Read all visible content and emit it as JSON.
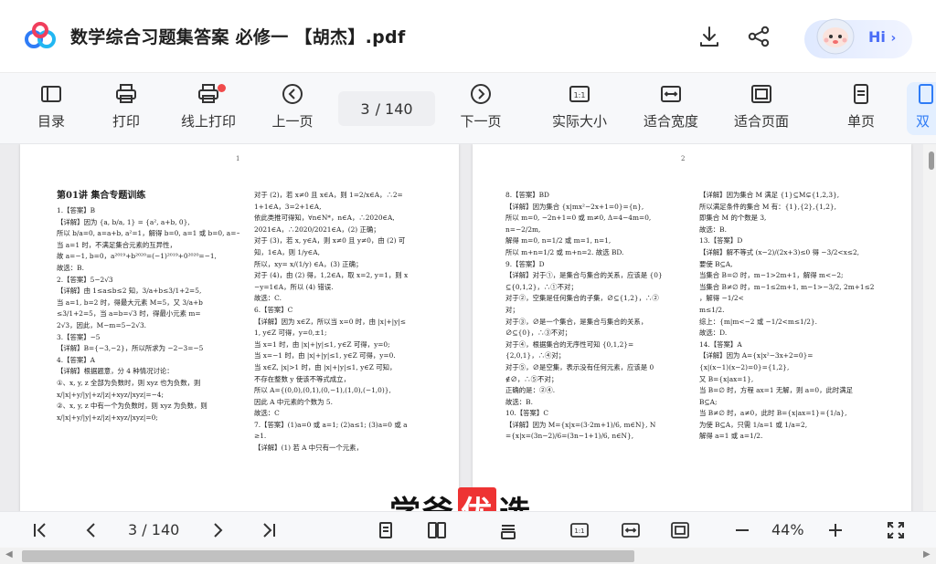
{
  "title_bar": {
    "document_title": "数学综合习题集答案 必修一 【胡杰】.pdf",
    "hi_button": "Hi",
    "icons": [
      "cloud-logo-icon",
      "download-icon",
      "share-icon",
      "assistant-avatar-icon",
      "chevron-right-icon"
    ]
  },
  "toolbar": {
    "items": [
      {
        "label": "目录",
        "icon": "toc-icon"
      },
      {
        "label": "打印",
        "icon": "printer-icon"
      },
      {
        "label": "线上打印",
        "icon": "online-print-icon"
      },
      {
        "label": "上一页",
        "icon": "prev-page-icon"
      },
      {
        "label": "下一页",
        "icon": "next-page-icon"
      },
      {
        "label": "实际大小",
        "icon": "actual-size-icon"
      },
      {
        "label": "适合宽度",
        "icon": "fit-width-icon"
      },
      {
        "label": "适合页面",
        "icon": "fit-page-icon"
      },
      {
        "label": "单页",
        "icon": "single-page-icon"
      },
      {
        "label": "双",
        "icon": "double-page-icon"
      }
    ],
    "page_current": "3",
    "page_total": "/ 140"
  },
  "document": {
    "left_page_number": "1",
    "right_page_number": "2",
    "left_col1": [
      "第01讲  集合专题训练",
      "1.【答案】B",
      "【详解】因为 {a, b/a, 1} = {a², a+b, 0},",
      "所以 b/a=0, a=a+b, a²=1，解得 b=0, a=1 或 b=0, a=−1,",
      "当 a=1 时，不满足集合元素的互异性，",
      "故 a=−1, b=0，a²⁰¹⁹+b²⁰²⁰=(−1)²⁰¹⁹+0²⁰²⁰=−1,",
      "故选：B.",
      "2.【答案】5−2√3",
      "【详解】由 1≤a≤b≤2 知，3/a+b≤3/1+2=5,",
      "当 a=1, b=2 时，得最大元素 M=5，又 3/a+b",
      "≤3/1+2=5，当 a=b=√3 时，得最小元素 m=",
      "2√3，因此，M−m=5−2√3.",
      "3.【答案】−5",
      "【详解】B={−3,−2}，所以所求为 −2−3=−5",
      "4.【答案】A",
      "【详解】根据题意，分 4 种情况讨论：",
      "①、x, y, z 全部为负数时，则 xyz 也为负数，则",
      "x/|x|+y/|y|+z/|z|+xyz/|xyz|=−4;",
      "②、x, y, z 中有一个为负数时，则 xyz 为负数，则",
      "x/|x|+y/|y|+z/|z|+xyz/|xyz|=0;"
    ],
    "left_col2": [
      "对于 (2)，若 x≠0 且 x∈A，则 1=2/x∈A，∴2=",
      "1+1∈A，3=2+1∈A,",
      "依此类推可得知，∀n∈N*，n∈A，∴2020∈A,",
      "2021∈A，∴2020/2021∈A，(2) 正确；",
      "对于 (3)，若 x, y∈A，则 x≠0 且 y≠0，由 (2) 可",
      "知，1∈A，则 1/y∈A,",
      "所以，xy= x/(1/y) ∈A，(3) 正确；",
      "对于 (4)，由 (2) 得，1,2∈A，取 x=2, y=1，则 x",
      "−y=1∈A，所以 (4) 错误.",
      "故选：C.",
      "6.【答案】C",
      "【详解】因为 x∈Z，所以当 x=0 时，由 |x|+|y|≤",
      "1, y∈Z 可得，y=0,±1;",
      "当 x=1 时，由 |x|+|y|≤1, y∈Z 可得，y=0;",
      "当 x=−1 时，由 |x|+|y|≤1, y∈Z 可得，y=0.",
      "当 x∈Z, |x|>1 时，由 |x|+|y|≤1, y∈Z 可知，",
      "不存在整数 y 使该不等式成立，",
      "所以 A={(0,0),(0,1),(0,−1),(1,0),(−1,0)},",
      "因此 A 中元素的个数为 5.",
      "故选：C",
      "7.【答案】(1)a=0 或 a=1; (2)a≤1; (3)a=0 或 a",
      "≥1.",
      "【详解】(1) 若 A 中只有一个元素，"
    ],
    "right_col1": [
      "8.【答案】BD",
      "【详解】因为集合 {x|mx²−2x+1=0}={n},",
      "所以 m=0, −2n+1=0 或 m≠0, Δ=4−4m=0,",
      "n=−2/2m,",
      "解得 m=0, n=1/2 或 m=1, n=1,",
      "所以 m+n=1/2 或 m+n=2. 故选 BD.",
      "9.【答案】D",
      "【详解】对于①，是集合与集合的关系，应该是 {0}",
      "⊆{0,1,2}，∴①不对；",
      "对于②，空集是任何集合的子集，∅⊆{1,2}，∴②",
      "对；",
      "对于③，∅是一个集合，是集合与集合的关系，",
      "∅⊆{0}，∴③不对；",
      "对于④，根据集合的无序性可知 {0,1,2}=",
      "{2,0,1}，∴④对；",
      "对于⑤，∅是空集，表示没有任何元素，应该是 0",
      "∉∅，∴⑤不对；",
      "正确的是：②④.",
      "故选：B.",
      "10.【答案】C",
      "【详解】因为 M={x|x=(3·2m+1)/6, m∈N}, N",
      "={x|x=(3n−2)/6=(3n−1+1)/6, n∈N},"
    ],
    "right_col2": [
      "【详解】因为集合 M 满足 {1}⊆M⊊{1,2,3},",
      "所以满足条件的集合 M 有：{1},{2},{1,2},",
      "即集合 M 的个数是 3,",
      "故选：B.",
      "13.【答案】D",
      "【详解】解不等式 (x−2)/(2x+3)≤0 得 −3/2<x≤2,",
      "要使 B⊆A,",
      "当集合 B=∅ 时，m−1>2m+1，解得 m<−2;",
      "当集合 B≠∅ 时，m−1≤2m+1, m−1>−3/2, 2m+1≤2",
      "，解得 −1/2<",
      "m≤1/2.",
      "综上：{m|m<−2 或 −1/2<m≤1/2}.",
      "故选：D.",
      "14.【答案】A",
      "【详解】因为 A={x|x²−3x+2=0}=",
      "{x|(x−1)(x−2)=0}={1,2},",
      "又 B={x|ax=1},",
      "当 B=∅ 时，方程 ax=1 无解，则 a=0，此时满足",
      "B⊆A;",
      "当 B≠∅ 时，a≠0，此时 B={x|ax=1}={1/a},",
      "为使 B⊆A，只需 1/a=1 或 1/a=2,",
      "解得 a=1 或 a=1/2."
    ]
  },
  "watermark": {
    "part1": "学爸",
    "part2": "优",
    "part3": "选"
  },
  "bottom_bar": {
    "page_current": "3",
    "page_total": "/ 140",
    "zoom": "44%",
    "icons": [
      "first-page-icon",
      "prev-page-icon",
      "next-page-icon",
      "last-page-icon",
      "single-page-icon",
      "double-page-icon",
      "scroll-page-icon",
      "actual-size-icon",
      "fit-width-icon",
      "fit-page-icon",
      "zoom-out-icon",
      "zoom-in-icon",
      "fullscreen-icon"
    ]
  },
  "colors": {
    "accent": "#4a6cf7",
    "red_dot": "#f04b4b",
    "toolbar_bg": "#f7f8fa",
    "doc_bg": "#ececee"
  }
}
